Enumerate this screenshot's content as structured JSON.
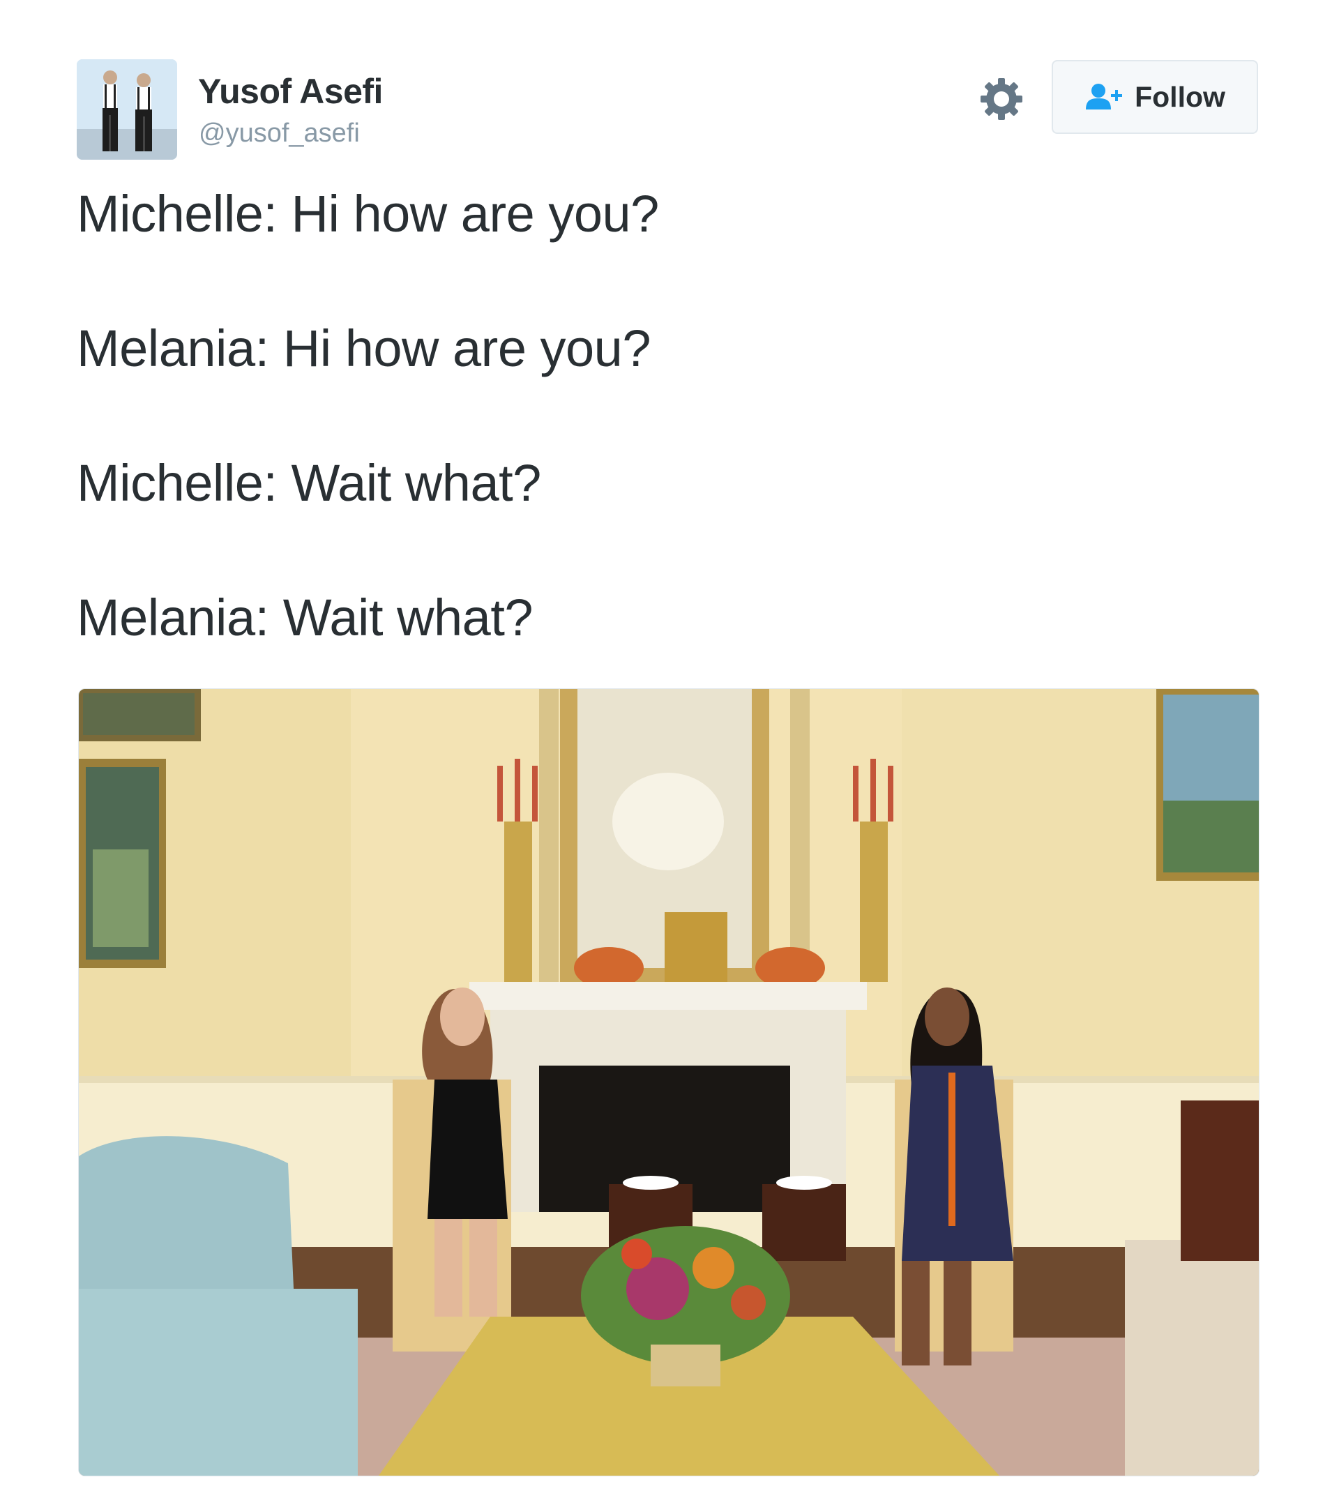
{
  "user": {
    "name": "Yusof Asefi",
    "handle": "@yusof_asefi",
    "avatar_icon": "two-men-suspenders-photo"
  },
  "actions": {
    "settings_icon": "gear-icon",
    "follow_icon": "add-person-icon",
    "follow_label": "Follow"
  },
  "tweet": {
    "lines": [
      "Michelle: Hi how are you?",
      "Melania: Hi how are you?",
      "Michelle: Wait what?",
      "Melania: Wait what?"
    ]
  },
  "colors": {
    "text": "#292f33",
    "muted": "#8899a6",
    "accent": "#1da1f2",
    "border": "#e1e8ed"
  }
}
